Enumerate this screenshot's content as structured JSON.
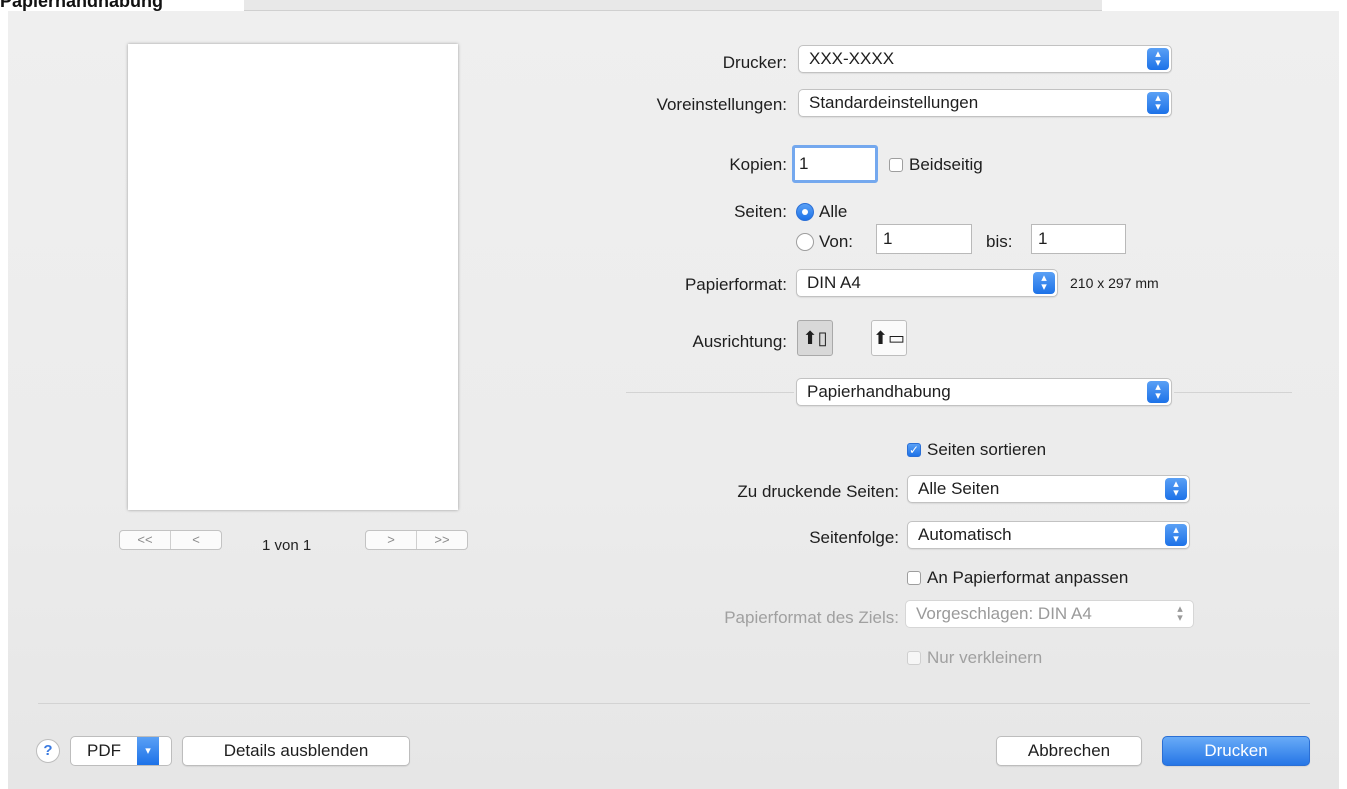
{
  "window": {
    "title": "Papierhandhabung"
  },
  "preview": {
    "page_count": "1 von 1",
    "nav_first": "<<",
    "nav_prev": "<",
    "nav_next": ">",
    "nav_last": ">>"
  },
  "printer": {
    "label": "Drucker:",
    "value": "XXX-XXXX"
  },
  "presets": {
    "label": "Voreinstellungen:",
    "value": "Standardeinstellungen"
  },
  "copies": {
    "label": "Kopien:",
    "value": "1",
    "duplex_label": "Beidseitig",
    "duplex_checked": false
  },
  "pages": {
    "label": "Seiten:",
    "all_label": "Alle",
    "from_label": "Von:",
    "from_value": "1",
    "to_label": "bis:",
    "to_value": "1",
    "selected": "all"
  },
  "paper_size": {
    "label": "Papierformat:",
    "value": "DIN A4",
    "dimensions": "210 x 297 mm"
  },
  "orientation": {
    "label": "Ausrichtung:",
    "selected": "portrait"
  },
  "section": {
    "value": "Papierhandhabung"
  },
  "collate": {
    "label": "Seiten sortieren",
    "checked": true
  },
  "pages_to_print": {
    "label": "Zu druckende Seiten:",
    "value": "Alle Seiten"
  },
  "page_order": {
    "label": "Seitenfolge:",
    "value": "Automatisch"
  },
  "scale_to_fit": {
    "label": "An Papierformat anpassen",
    "checked": false
  },
  "destination_paper": {
    "label": "Papierformat des Ziels:",
    "value": "Vorgeschlagen: DIN A4",
    "enabled": false
  },
  "scale_down_only": {
    "label": "Nur verkleinern",
    "enabled": false
  },
  "footer": {
    "help": "?",
    "pdf": "PDF",
    "hide_details": "Details ausblenden",
    "cancel": "Abbrechen",
    "print": "Drucken"
  },
  "colors": {
    "accent": "#1d72e8",
    "sheet_bg": "#ececec"
  }
}
